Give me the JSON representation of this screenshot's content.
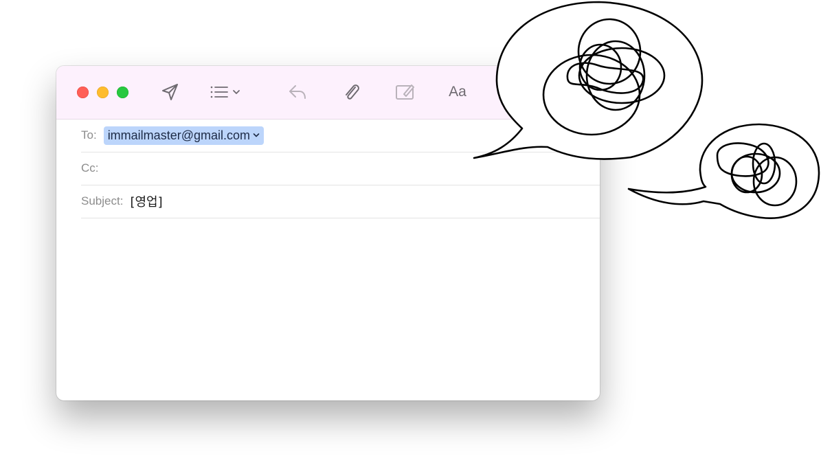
{
  "compose": {
    "to_label": "To:",
    "to_value": "immailmaster@gmail.com",
    "cc_label": "Cc:",
    "cc_value": "",
    "subject_label": "Subject:",
    "subject_value": "[영업]",
    "body": ""
  },
  "toolbar": {
    "send_icon": "send-icon",
    "list_icon": "list-format-icon",
    "reply_icon": "reply-icon",
    "attach_icon": "paperclip-icon",
    "markup_icon": "markup-icon",
    "font_label": "Aa"
  },
  "window_controls": [
    "close",
    "minimize",
    "zoom"
  ],
  "decorations": [
    "speech-bubble-scribble-large",
    "speech-bubble-scribble-small"
  ],
  "colors": {
    "toolbar_bg": "#fdf1fd",
    "recipient_token_bg": "#bcd5fb",
    "close": "#ff5f57",
    "minimize": "#febc2e",
    "zoom": "#28c840"
  }
}
